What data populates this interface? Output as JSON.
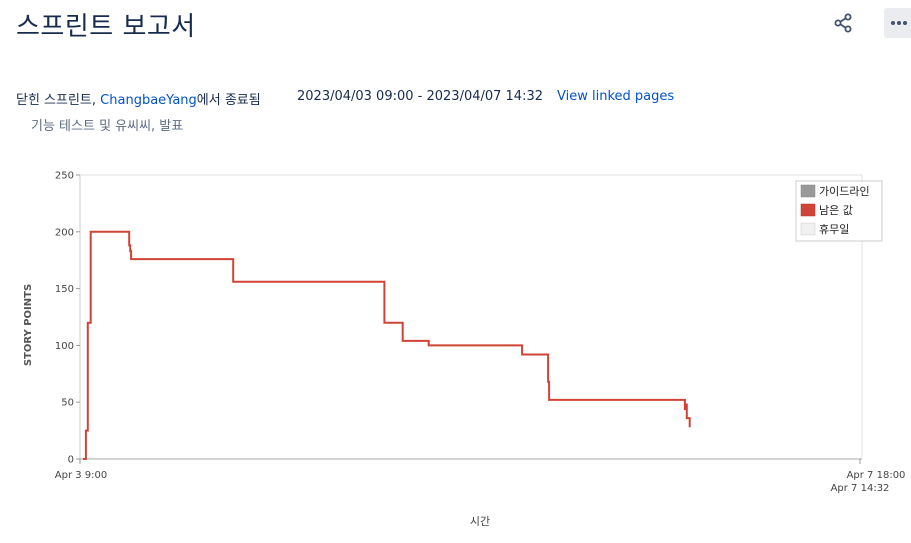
{
  "page": {
    "title": "스프린트 보고서"
  },
  "header": {
    "share_icon": "share-icon",
    "more_icon": "more-icon"
  },
  "sprint": {
    "status_prefix": "닫힌 스프린트, ",
    "user": "ChangbaeYang",
    "status_suffix": "에서 종료됨",
    "date_range": "2023/04/03 09:00 - 2023/04/07 14:32",
    "linked_pages": "View linked pages",
    "goal": "기능 테스트 및 유씨씨, 발표"
  },
  "colors": {
    "remaining": "#d04437",
    "guideline": "#999999",
    "nonworking": "#f0f0f0",
    "link": "#0052cc"
  },
  "chart_data": {
    "type": "line",
    "ylabel": "STORY POINTS",
    "xlabel": "시간",
    "ylim": [
      0,
      250
    ],
    "yticks": [
      "0",
      "50",
      "100",
      "150",
      "200",
      "250"
    ],
    "x_start_label": "Apr 3 9:00",
    "x_end_label": "Apr 7 18:00",
    "x_end_label2": "Apr 7 14:32",
    "legend": [
      {
        "name": "가이드라인",
        "color": "#999999"
      },
      {
        "name": "남은 값",
        "color": "#d04437"
      },
      {
        "name": "휴무일",
        "color": "#f0f0f0"
      }
    ],
    "series": [
      {
        "name": "남은 값",
        "x_hours": [
          0,
          0.3,
          0.5,
          0.8,
          4.6,
          4.8,
          4.9,
          5.0,
          15.6,
          31.3,
          33.2,
          35.9,
          45.6,
          48.3,
          48.4,
          48.5,
          62.5,
          62.6,
          62.7,
          63.0
        ],
        "values": [
          0,
          25,
          120,
          200,
          200,
          188,
          183,
          176,
          156,
          120,
          104,
          100,
          92,
          68,
          52,
          52,
          44,
          48,
          36,
          28
        ]
      }
    ]
  }
}
